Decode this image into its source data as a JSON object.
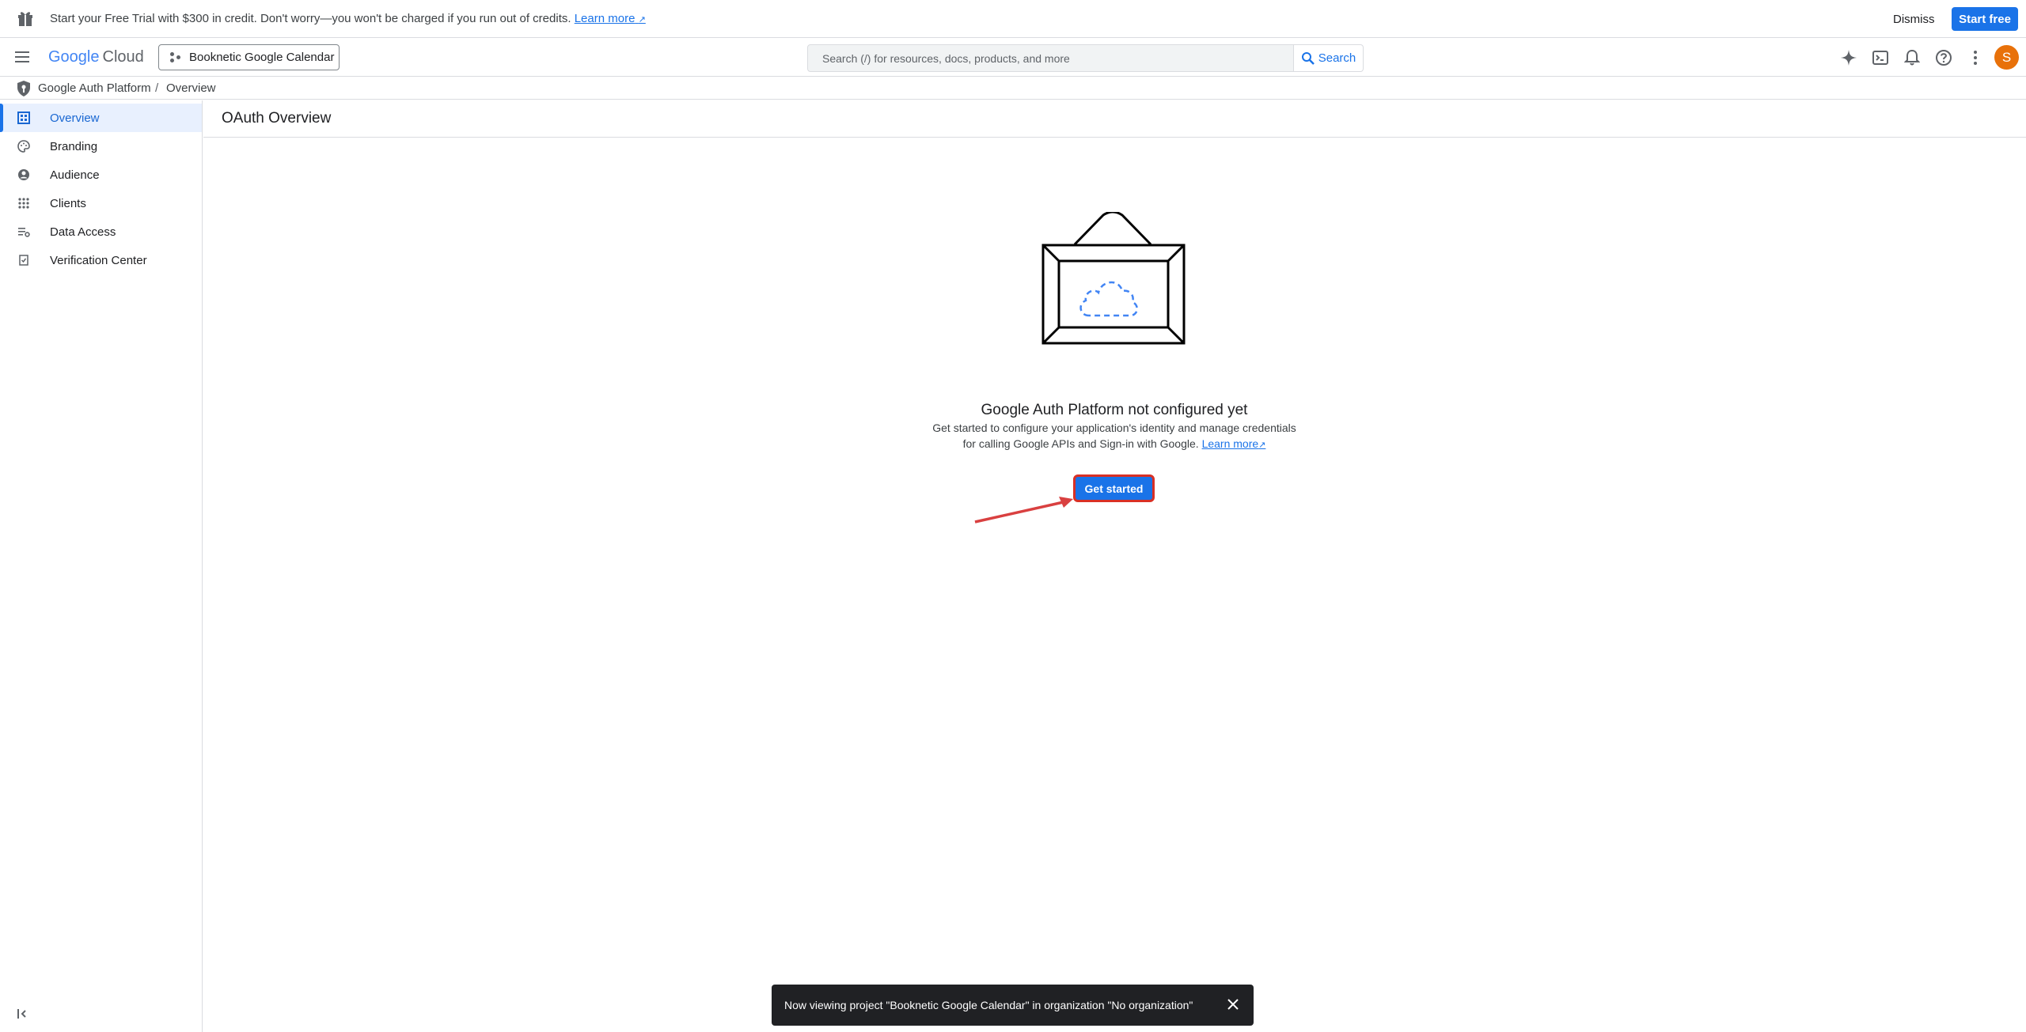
{
  "promo": {
    "message": "Start your Free Trial with $300 in credit. Don't worry—you won't be charged if you run out of credits.",
    "learn_more": "Learn more",
    "dismiss": "Dismiss",
    "start_free": "Start free"
  },
  "header": {
    "logo_google": "Google",
    "logo_cloud": "Cloud",
    "project": "Booknetic Google Calendar",
    "search_placeholder": "Search (/) for resources, docs, products, and more",
    "search_button": "Search",
    "avatar_initial": "S"
  },
  "breadcrumb": {
    "items": [
      "Google Auth Platform",
      "Overview"
    ],
    "separator": "/"
  },
  "sidebar": {
    "items": [
      {
        "label": "Overview",
        "icon": "dashboard-icon",
        "active": true
      },
      {
        "label": "Branding",
        "icon": "palette-icon"
      },
      {
        "label": "Audience",
        "icon": "account-circle-icon"
      },
      {
        "label": "Clients",
        "icon": "apps-grid-icon"
      },
      {
        "label": "Data Access",
        "icon": "data-access-icon"
      },
      {
        "label": "Verification Center",
        "icon": "verification-icon"
      }
    ],
    "collapse_icon": "collapse-sidebar-icon"
  },
  "main": {
    "title": "OAuth Overview",
    "empty_title": "Google Auth Platform not configured yet",
    "empty_desc_line1": "Get started to configure your application's identity and manage credentials",
    "empty_desc_line2": "for calling Google APIs and Sign-in with Google.",
    "learn_more": "Learn more",
    "get_started": "Get started"
  },
  "snackbar": {
    "message": "Now viewing project \"Booknetic Google Calendar\" in organization \"No organization\""
  },
  "colors": {
    "primary": "#1a73e8",
    "highlight": "#d93025",
    "avatar": "#e8710a"
  }
}
